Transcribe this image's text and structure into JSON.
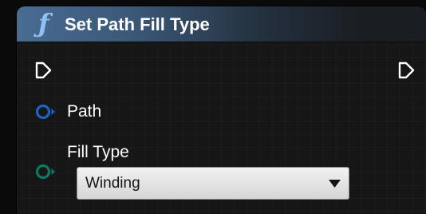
{
  "node": {
    "icon": "function-icon",
    "title": "Set Path Fill Type",
    "header_color": "#496c92"
  },
  "pins": {
    "exec_in": {
      "icon": "exec-pin-icon",
      "connected": false
    },
    "exec_out": {
      "icon": "exec-pin-icon",
      "connected": false
    },
    "path": {
      "label": "Path",
      "color": "#1a63c9",
      "connected": false
    },
    "fill_type": {
      "label": "Fill Type",
      "color": "#0b7a64",
      "connected": false
    }
  },
  "fill_type_dropdown": {
    "value": "Winding",
    "icon": "chevron-down-icon"
  }
}
